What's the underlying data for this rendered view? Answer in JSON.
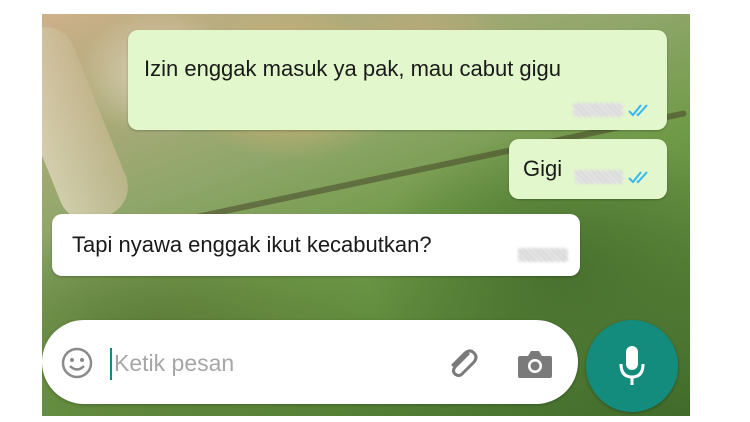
{
  "conversation": {
    "messages": [
      {
        "direction": "outgoing",
        "text": "Izin enggak masuk ya pak, mau cabut gigu",
        "status": "read"
      },
      {
        "direction": "outgoing",
        "text": "Gigi",
        "status": "read"
      },
      {
        "direction": "incoming",
        "text": "Tapi nyawa enggak ikut kecabutkan?"
      }
    ]
  },
  "composer": {
    "placeholder": "Ketik pesan",
    "icons": {
      "emoji": "emoji-icon",
      "attach": "paperclip-icon",
      "camera": "camera-icon",
      "mic": "microphone-icon"
    }
  },
  "colors": {
    "outgoing_bubble": "#e2f7cb",
    "incoming_bubble": "#ffffff",
    "read_ticks": "#34b7f1",
    "accent": "#138c7e"
  }
}
